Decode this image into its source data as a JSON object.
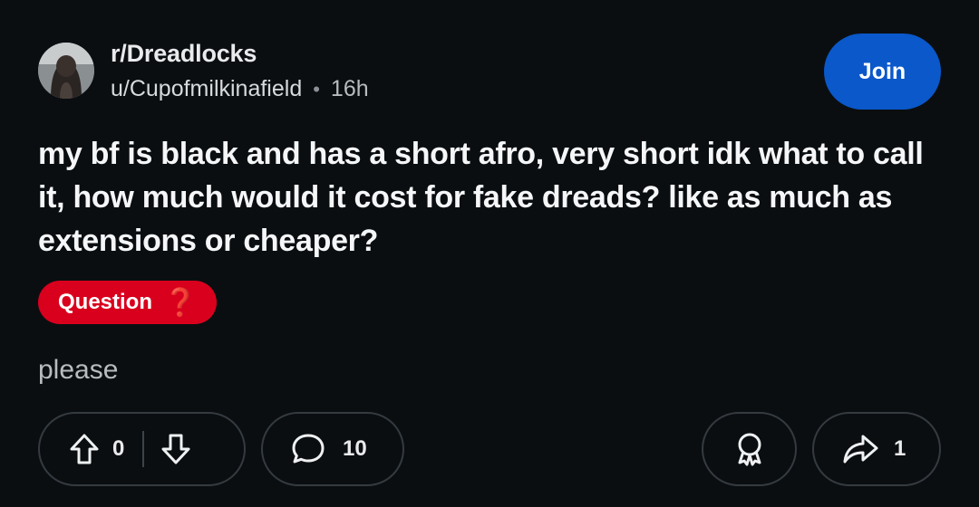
{
  "post": {
    "subreddit": "r/Dreadlocks",
    "author": "u/Cupofmilkinafield",
    "separator": "•",
    "time_ago": "16h",
    "join_label": "Join",
    "title": "my bf is black and has a short afro, very short idk what to call it, how much would it cost for fake dreads? like as much as extensions or cheaper?",
    "flair": {
      "label": "Question",
      "emoji": "❓",
      "color": "#d9001d"
    },
    "body": "please"
  },
  "actions": {
    "upvote_icon": "arrow-up-icon",
    "vote_count": "0",
    "downvote_icon": "arrow-down-icon",
    "comment_icon": "speech-bubble-icon",
    "comment_count": "10",
    "award_icon": "award-ribbon-icon",
    "share_icon": "share-arrow-icon",
    "share_count": "1"
  },
  "colors": {
    "background": "#0b0e11",
    "join_button": "#0a58ca",
    "pill_border": "#343b40"
  }
}
